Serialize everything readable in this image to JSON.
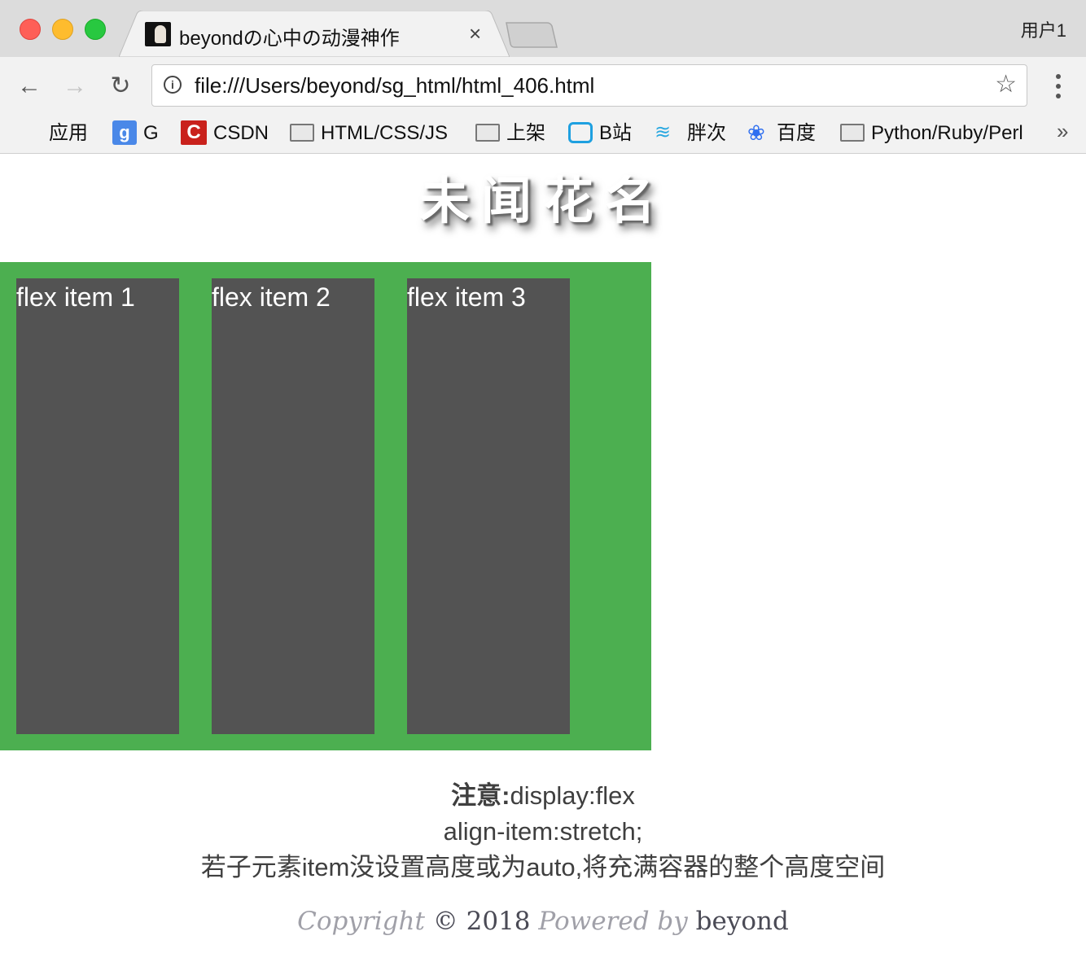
{
  "window": {
    "user_label": "用户1"
  },
  "tab": {
    "title": "beyondの心中の动漫神作",
    "close_glyph": "×"
  },
  "toolbar": {
    "url": "file:///Users/beyond/sg_html/html_406.html",
    "back_glyph": "←",
    "forward_glyph": "→",
    "reload_glyph": "↻",
    "star_glyph": "☆",
    "info_glyph": "i"
  },
  "bookmarks": {
    "items": [
      {
        "label": "应用",
        "icon": "apps-grid-icon"
      },
      {
        "label": "G",
        "icon": "google-icon"
      },
      {
        "label": "CSDN",
        "icon": "csdn-icon"
      },
      {
        "label": "HTML/CSS/JS",
        "icon": "folder-icon"
      },
      {
        "label": "上架",
        "icon": "folder-icon"
      },
      {
        "label": "B站",
        "icon": "bilibili-icon"
      },
      {
        "label": "胖次",
        "icon": "wave-icon"
      },
      {
        "label": "百度",
        "icon": "baidu-paw-icon"
      },
      {
        "label": "Python/Ruby/Perl",
        "icon": "folder-icon"
      }
    ],
    "overflow_glyph": "»"
  },
  "page": {
    "title": "未闻花名",
    "flex_items": [
      "flex item 1",
      "flex item 2",
      "flex item 3"
    ],
    "notes": {
      "line1_bold": "注意:",
      "line1_rest": "display:flex",
      "line2": "align-item:stretch;",
      "line3": "若子元素item没设置高度或为auto,将充满容器的整个高度空间"
    },
    "footer": {
      "copyright": "Copyright",
      "symbol_year": "© 2018",
      "powered_by": "Powered by",
      "author": "beyond"
    }
  },
  "colors": {
    "container_bg": "#4caf50",
    "item_bg": "#535353"
  }
}
